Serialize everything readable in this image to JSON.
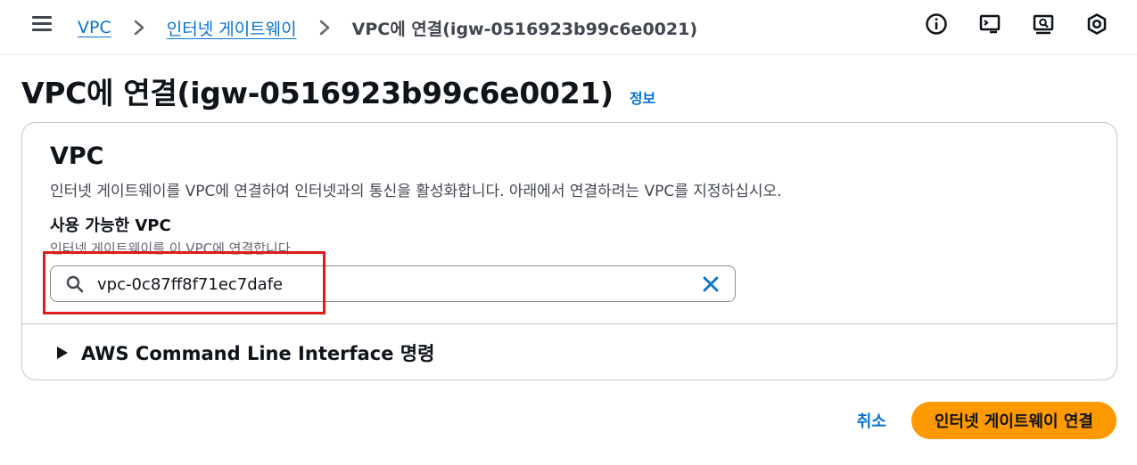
{
  "breadcrumb": {
    "items": [
      "VPC",
      "인터넷 게이트웨이"
    ],
    "current": "VPC에 연결(igw-0516923b99c6e0021)"
  },
  "header": {
    "icons": [
      "info-icon",
      "cloudshell-icon",
      "feedback-icon",
      "settings-icon"
    ]
  },
  "page": {
    "title": "VPC에 연결(igw-0516923b99c6e0021)",
    "info_link": "정보"
  },
  "card": {
    "title": "VPC",
    "description": "인터넷 게이트웨이를 VPC에 연결하여 인터넷과의 통신을 활성화합니다. 아래에서 연결하려는 VPC를 지정하십시오.",
    "field_label": "사용 가능한 VPC",
    "field_hint": "인터넷 게이트웨이를 이 VPC에 연결합니다.",
    "search_value": "vpc-0c87ff8f71ec7dafe",
    "expander_label": "AWS Command Line Interface 명령"
  },
  "actions": {
    "cancel": "취소",
    "submit": "인터넷 게이트웨이 연결"
  },
  "colors": {
    "link": "#0972d3",
    "primary": "#ff9900",
    "highlight": "#dd1c1c"
  }
}
